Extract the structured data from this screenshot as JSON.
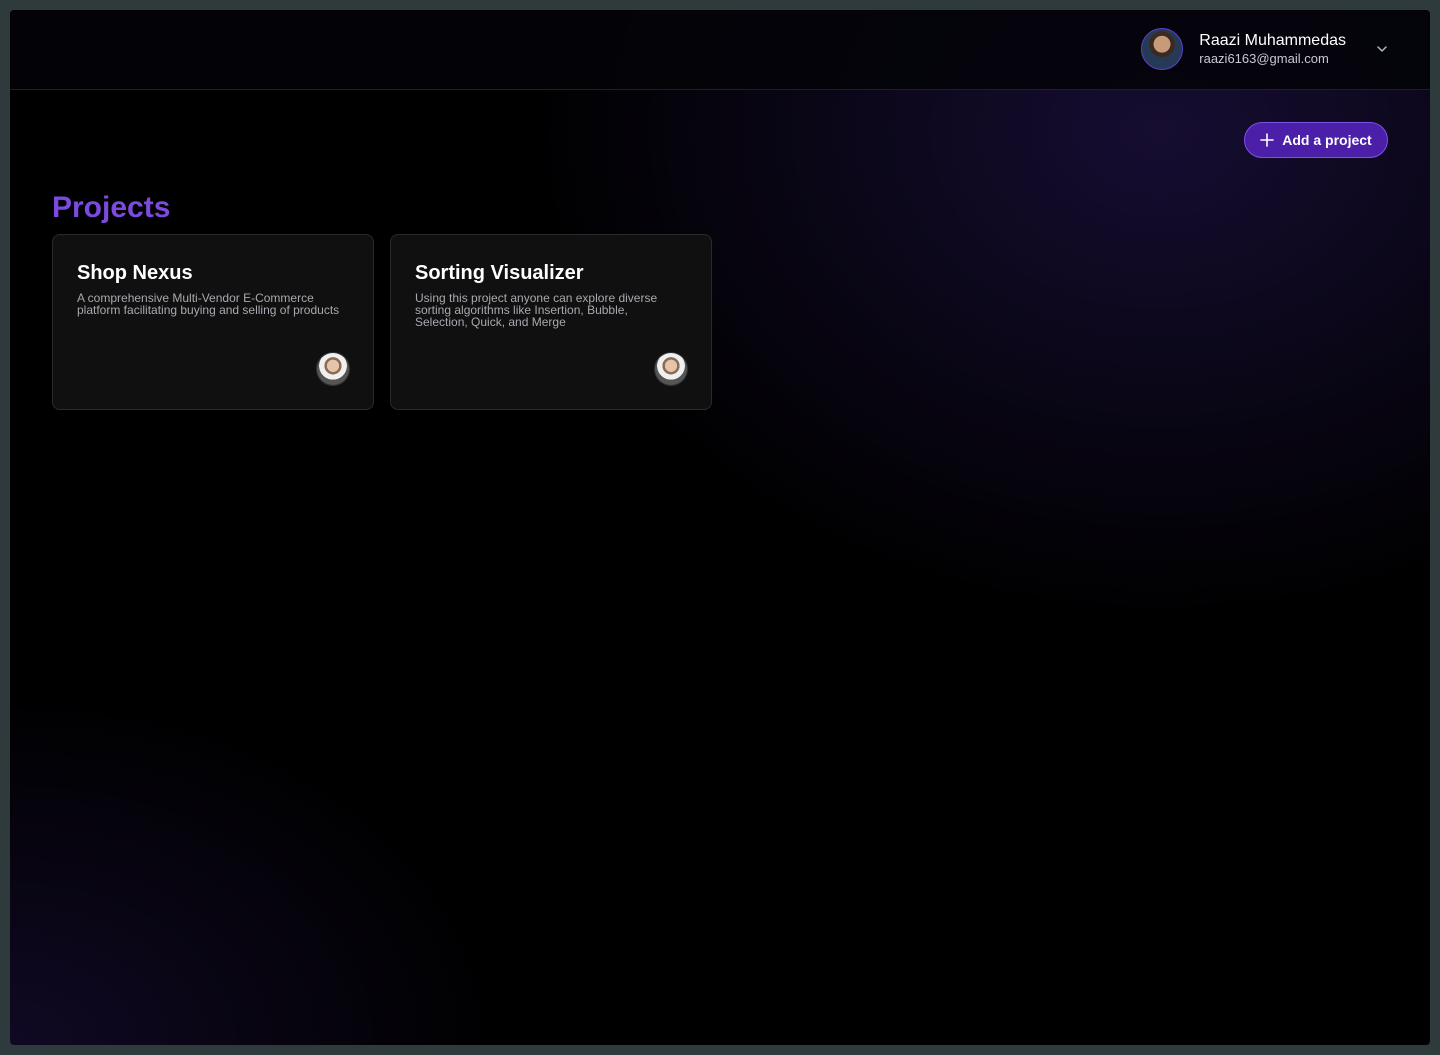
{
  "user": {
    "name": "Raazi Muhammedas",
    "email": "raazi6163@gmail.com"
  },
  "actions": {
    "add_project_label": "Add a project"
  },
  "page": {
    "title": "Projects"
  },
  "projects": [
    {
      "title": "Shop Nexus",
      "description": "A comprehensive Multi-Vendor E-Commerce platform facilitating buying and selling of products"
    },
    {
      "title": "Sorting Visualizer",
      "description": "Using this project anyone can explore diverse sorting algorithms like Insertion, Bubble, Selection, Quick, and Merge"
    }
  ],
  "colors": {
    "accent": "#7d4ae0",
    "button_bg": "#4b1fa8",
    "card_bg": "#101010"
  }
}
